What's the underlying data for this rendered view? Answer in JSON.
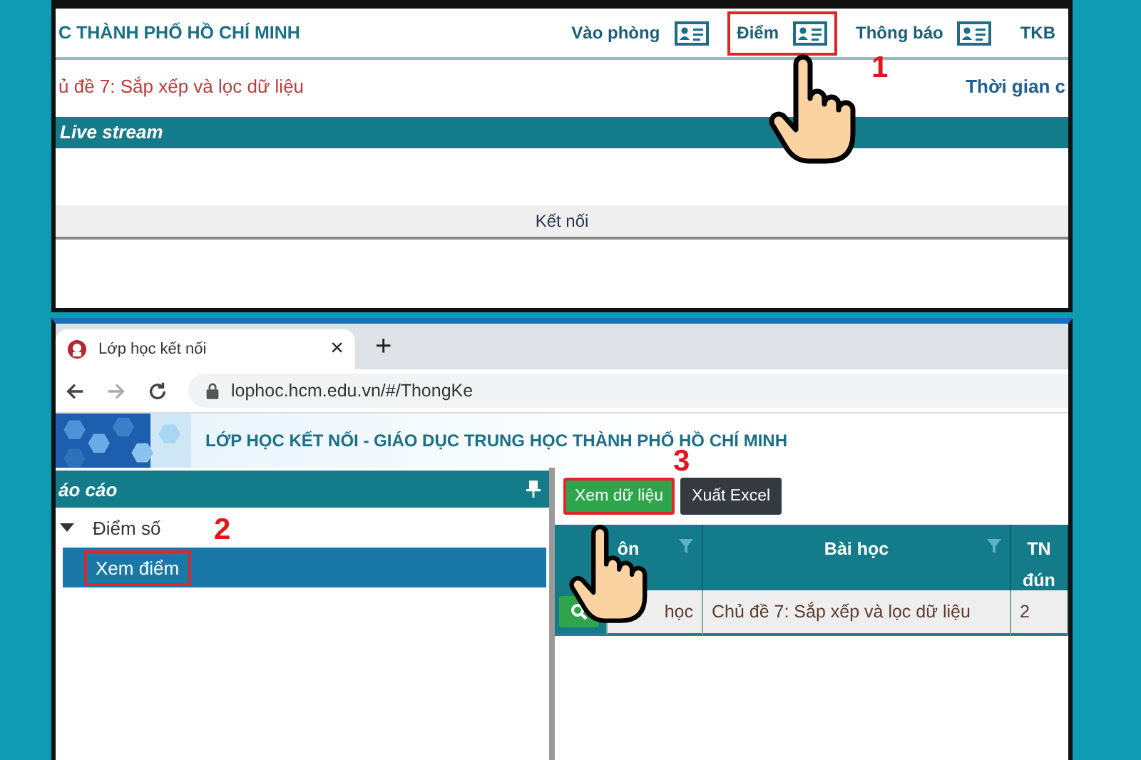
{
  "top_screen": {
    "site_title": "C THÀNH PHỐ HỒ CHÍ MINH",
    "nav": [
      {
        "label": "Vào phòng",
        "kind": "with_icon",
        "highlighted": false
      },
      {
        "label": "Điểm",
        "kind": "with_icon",
        "highlighted": true
      },
      {
        "label": "Thông báo",
        "kind": "with_icon",
        "highlighted": false
      },
      {
        "label": "TKB",
        "kind": "text",
        "highlighted": false
      }
    ],
    "lesson_title": "ủ đề 7: Sắp xếp và lọc dữ liệu",
    "time_label": "Thời gian c",
    "panel_title": "Live stream",
    "connect_button": "Kết nối"
  },
  "bottom_screen": {
    "browser_tab": {
      "title": "Lớp học kết nối",
      "close": "×"
    },
    "new_tab": "+",
    "url": "lophoc.hcm.edu.vn/#/ThongKe",
    "banner_title": "LỚP HỌC KẾT NỐI -  GIÁO DỤC TRUNG HỌC THÀNH PHỐ HỒ CHÍ MINH",
    "sidebar": {
      "title": "áo cáo",
      "tree": [
        {
          "label": "Điểm số",
          "expanded": true,
          "selected": false,
          "highlighted": false,
          "children": [
            {
              "label": "Xem điểm",
              "selected": true,
              "highlighted": true
            }
          ]
        }
      ]
    },
    "toolbar": [
      {
        "label": "Xem dữ liệu",
        "kind": "primary",
        "highlighted": true
      },
      {
        "label": "Xuất Excel",
        "kind": "dark",
        "highlighted": false
      }
    ],
    "table": {
      "columns": [
        {
          "label": "ôn",
          "filter": true
        },
        {
          "label": "Bài học",
          "filter": true
        },
        {
          "label": "TN đún",
          "filter": false
        }
      ],
      "rows": [
        [
          "học",
          "Chủ đề 7: Sắp xếp và lọc dữ liệu",
          "2"
        ]
      ]
    }
  },
  "step_numbers": [
    "1",
    "2",
    "3"
  ]
}
